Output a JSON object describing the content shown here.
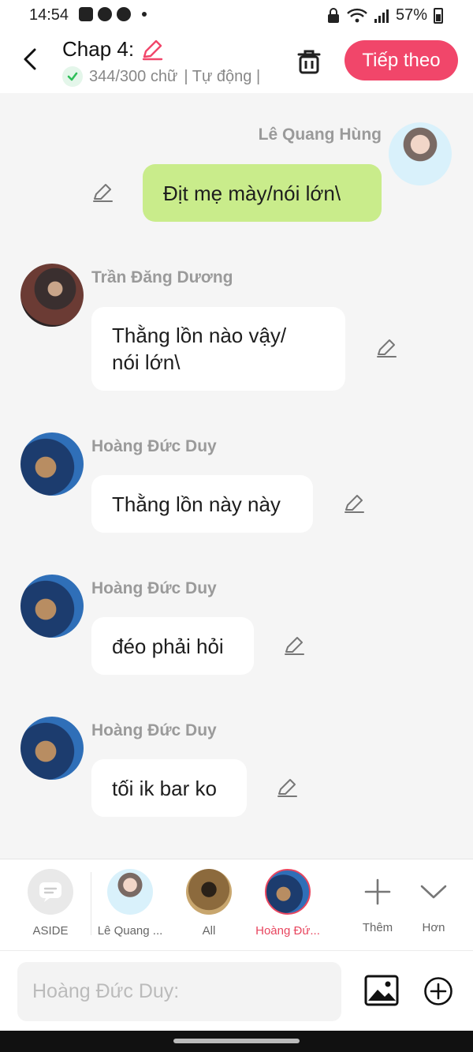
{
  "status_bar": {
    "time": "14:54",
    "battery": "57%"
  },
  "header": {
    "title": "Chap 4:",
    "word_count": "344/300 chữ",
    "mode": "| Tự động |",
    "next_button": "Tiếp theo"
  },
  "messages": [
    {
      "side": "right",
      "sender": "Lê Quang Hùng",
      "text": "Địt mẹ mày/nói lớn\\"
    },
    {
      "side": "left",
      "sender": "Trần Đăng Dương",
      "lines": [
        "Thằng lồn nào vậy/",
        "nói lớn\\"
      ]
    },
    {
      "side": "left",
      "sender": "Hoàng Đức Duy",
      "text": "Thằng lồn này này"
    },
    {
      "side": "left",
      "sender": "Hoàng Đức Duy",
      "text": "đéo phải hỏi"
    },
    {
      "side": "left",
      "sender": "Hoàng Đức Duy",
      "text": "tối ik bar ko"
    }
  ],
  "character_bar": {
    "items": [
      {
        "label": "ASIDE",
        "icon": "chat-bubble-icon"
      },
      {
        "label": "Lê Quang ..."
      },
      {
        "label": "All"
      },
      {
        "label": "Hoàng Đứ...",
        "active": true
      },
      {
        "label": "Thêm",
        "icon": "plus-icon"
      },
      {
        "label": "Hơn",
        "icon": "chevron-down-icon"
      }
    ],
    "active_color": "#e8465f"
  },
  "composer": {
    "placeholder": "Hoàng Đức Duy:"
  },
  "colors": {
    "accent": "#f1466a",
    "own_bubble": "#c9ec8b",
    "background": "#f5f5f5"
  }
}
